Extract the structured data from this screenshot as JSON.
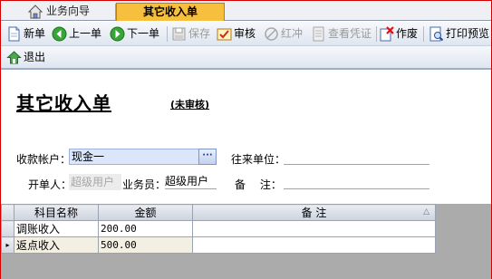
{
  "tabs": [
    {
      "label": "业务向导",
      "active": false
    },
    {
      "label": "其它收入单",
      "active": true
    }
  ],
  "toolbar": {
    "new": "新单",
    "prev": "上一单",
    "next": "下一单",
    "save": "保存",
    "audit": "审核",
    "reverse": "红冲",
    "voucher": "查看凭证",
    "void": "作废",
    "print_preview": "打印预览",
    "exit": "退出"
  },
  "doc": {
    "title": "其它收入单",
    "status": "(未审核)"
  },
  "form": {
    "account_label": "收款帐户：",
    "account_value": "现金一",
    "account_button": "···",
    "partner_label": "往来单位：",
    "partner_value": "",
    "creator_label": "开单人：",
    "creator_value": "超级用户",
    "salesman_label": "业务员：",
    "salesman_value": "超级用户",
    "remark_label": "备　 注：",
    "remark_value": ""
  },
  "grid": {
    "columns": [
      "科目名称",
      "金额",
      "备 注"
    ],
    "sort_indicator": "△",
    "rows": [
      {
        "subject": "调账收入",
        "amount": "200.00",
        "remark": ""
      },
      {
        "subject": "返点收入",
        "amount": "500.00",
        "remark": ""
      }
    ]
  },
  "colors": {
    "active_tab": "#f7bf3e",
    "frame_border": "#d40000",
    "account_field_bg": "#dce6fb"
  }
}
